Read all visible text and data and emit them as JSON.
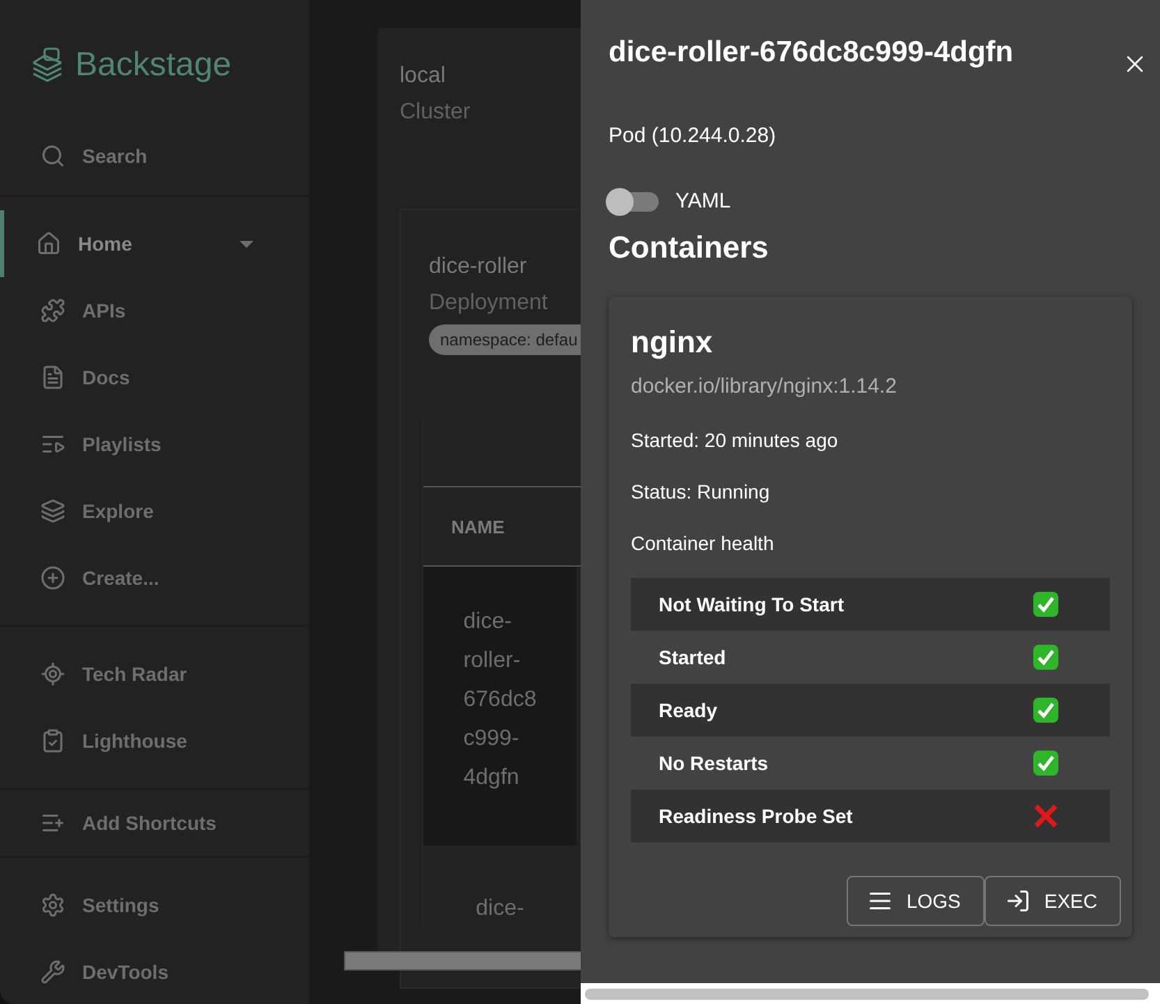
{
  "sidebar": {
    "logo": "Backstage",
    "search": "Search",
    "groups": [
      [
        {
          "label": "Home",
          "selected": true,
          "expandable": true
        },
        {
          "label": "APIs",
          "selected": false,
          "expandable": false
        },
        {
          "label": "Docs",
          "selected": false,
          "expandable": false
        },
        {
          "label": "Playlists",
          "selected": false,
          "expandable": false
        },
        {
          "label": "Explore",
          "selected": false,
          "expandable": false
        },
        {
          "label": "Create...",
          "selected": false,
          "expandable": false
        }
      ],
      [
        {
          "label": "Tech Radar",
          "selected": false,
          "expandable": false
        },
        {
          "label": "Lighthouse",
          "selected": false,
          "expandable": false
        }
      ],
      [
        {
          "label": "Add Shortcuts",
          "selected": false,
          "expandable": false
        }
      ],
      [
        {
          "label": "Settings",
          "selected": false,
          "expandable": false
        },
        {
          "label": "DevTools",
          "selected": false,
          "expandable": false
        }
      ]
    ]
  },
  "cluster": {
    "name": "local",
    "type": "Cluster"
  },
  "deployment": {
    "name": "dice-roller",
    "type": "Deployment",
    "chip": "namespace: defau",
    "table": {
      "columns": [
        "NAME"
      ],
      "rows": [
        [
          "dice-",
          "roller-",
          "676dc8",
          "c999-",
          "4dgfn"
        ],
        [
          "dice-"
        ]
      ]
    }
  },
  "drawer": {
    "title": "dice-roller-676dc8c999-4dgfn",
    "subtitle": "Pod (10.244.0.28)",
    "toggle": {
      "label": "YAML",
      "on": false
    },
    "heading": "Containers",
    "container": {
      "name": "nginx",
      "image": "docker.io/library/nginx:1.14.2",
      "started": "Started: 20 minutes ago",
      "status": "Status: Running",
      "health_label": "Container health",
      "health": [
        {
          "label": "Not Waiting To Start",
          "ok": true
        },
        {
          "label": "Started",
          "ok": true
        },
        {
          "label": "Ready",
          "ok": true
        },
        {
          "label": "No Restarts",
          "ok": true
        },
        {
          "label": "Readiness Probe Set",
          "ok": false
        }
      ],
      "buttons": [
        {
          "label": "LOGS",
          "kind": "logs"
        },
        {
          "label": "EXEC",
          "kind": "exec"
        }
      ]
    }
  }
}
